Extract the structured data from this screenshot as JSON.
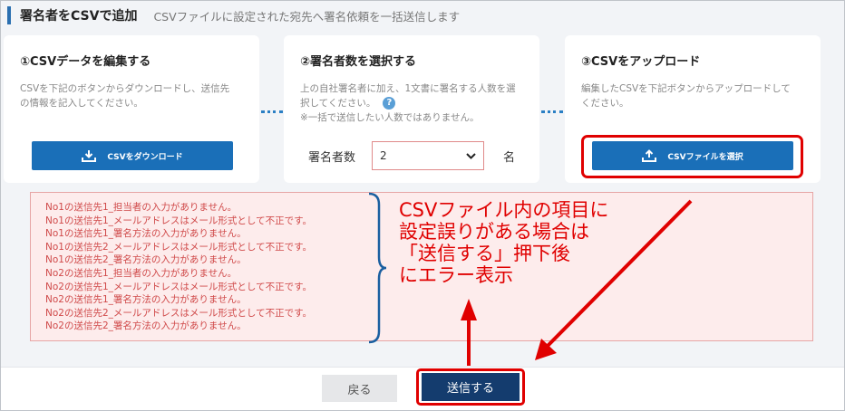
{
  "header": {
    "title": "署名者をCSVで追加",
    "description": "CSVファイルに設定された宛先へ署名依頼を一括送信します"
  },
  "step1": {
    "title": "①CSVデータを編集する",
    "desc_line1": "CSVを下記のボタンからダウンロードし、送信先",
    "desc_line2": "の情報を記入してください。",
    "button_label": "CSVをダウンロード"
  },
  "step2": {
    "title": "②署名者数を選択する",
    "desc_line1": "上の自社署名者に加え、1文書に署名する人数を選",
    "desc_line2": "択してください。",
    "help_icon": "?",
    "note": "※一括で送信したい人数ではありません。",
    "select_label": "署名者数",
    "select_value": "2",
    "select_unit": "名"
  },
  "step3": {
    "title": "③CSVをアップロード",
    "desc_line1": "編集したCSVを下記ボタンからアップロードして",
    "desc_line2": "ください。",
    "button_label": "CSVファイルを選択"
  },
  "errors": [
    "No1の送信先1_担当者の入力がありません。",
    "No1の送信先1_メールアドレスはメール形式として不正です。",
    "No1の送信先1_署名方法の入力がありません。",
    "No1の送信先2_メールアドレスはメール形式として不正です。",
    "No1の送信先2_署名方法の入力がありません。",
    "No2の送信先1_担当者の入力がありません。",
    "No2の送信先1_メールアドレスはメール形式として不正です。",
    "No2の送信先1_署名方法の入力がありません。",
    "No2の送信先2_メールアドレスはメール形式として不正です。",
    "No2の送信先2_署名方法の入力がありません。"
  ],
  "annotation": {
    "line1": "CSVファイル内の項目に",
    "line2": "設定誤りがある場合は",
    "line3": "「送信する」押下後",
    "line4": "にエラー表示"
  },
  "footer": {
    "back_label": "戻る",
    "send_label": "送信する"
  },
  "colors": {
    "primary": "#1a6fb8",
    "send": "#143c6e",
    "error_text": "#d04a4a",
    "error_bg": "#fdecec",
    "annotation": "#e00000"
  }
}
